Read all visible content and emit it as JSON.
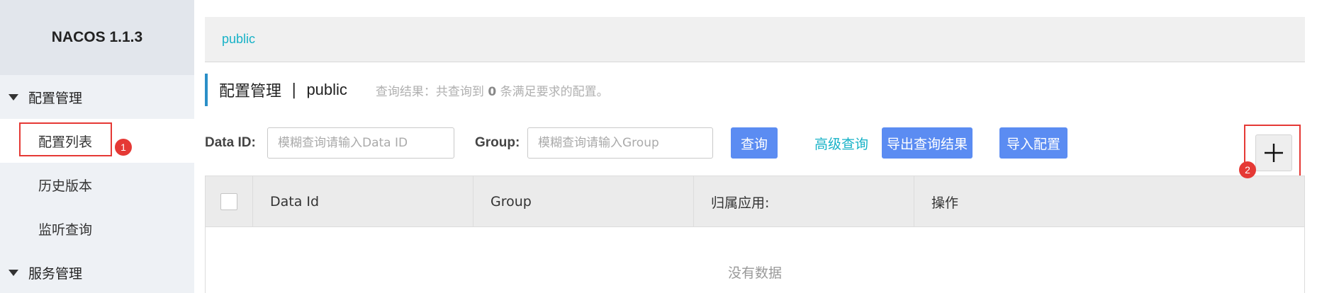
{
  "sidebar": {
    "brand": "NACOS 1.1.3",
    "groups": [
      {
        "label": "配置管理",
        "items": [
          {
            "label": "配置列表"
          },
          {
            "label": "历史版本"
          },
          {
            "label": "监听查询"
          }
        ]
      },
      {
        "label": "服务管理"
      }
    ]
  },
  "annotations": {
    "badge1": "1",
    "badge2": "2",
    "color": "#e53935"
  },
  "namespace_bar": {
    "current": "public"
  },
  "title": {
    "main": "配置管理",
    "separator": "|",
    "namespace": "public",
    "result_prefix": "查询结果：共查询到",
    "result_count": "0",
    "result_suffix": "条满足要求的配置。"
  },
  "filters": {
    "data_id_label": "Data ID:",
    "data_id_placeholder": "模糊查询请输入Data ID",
    "group_label": "Group:",
    "group_placeholder": "模糊查询请输入Group",
    "query_button": "查询",
    "advanced_query": "高级查询",
    "export_button": "导出查询结果",
    "import_button": "导入配置",
    "add_icon": "plus-icon"
  },
  "table": {
    "columns": [
      "Data Id",
      "Group",
      "归属应用:",
      "操作"
    ],
    "empty_text": "没有数据"
  },
  "colors": {
    "primary": "#5b8cf2",
    "link": "#17b2c7",
    "accent_bar": "#2b8fc7"
  }
}
